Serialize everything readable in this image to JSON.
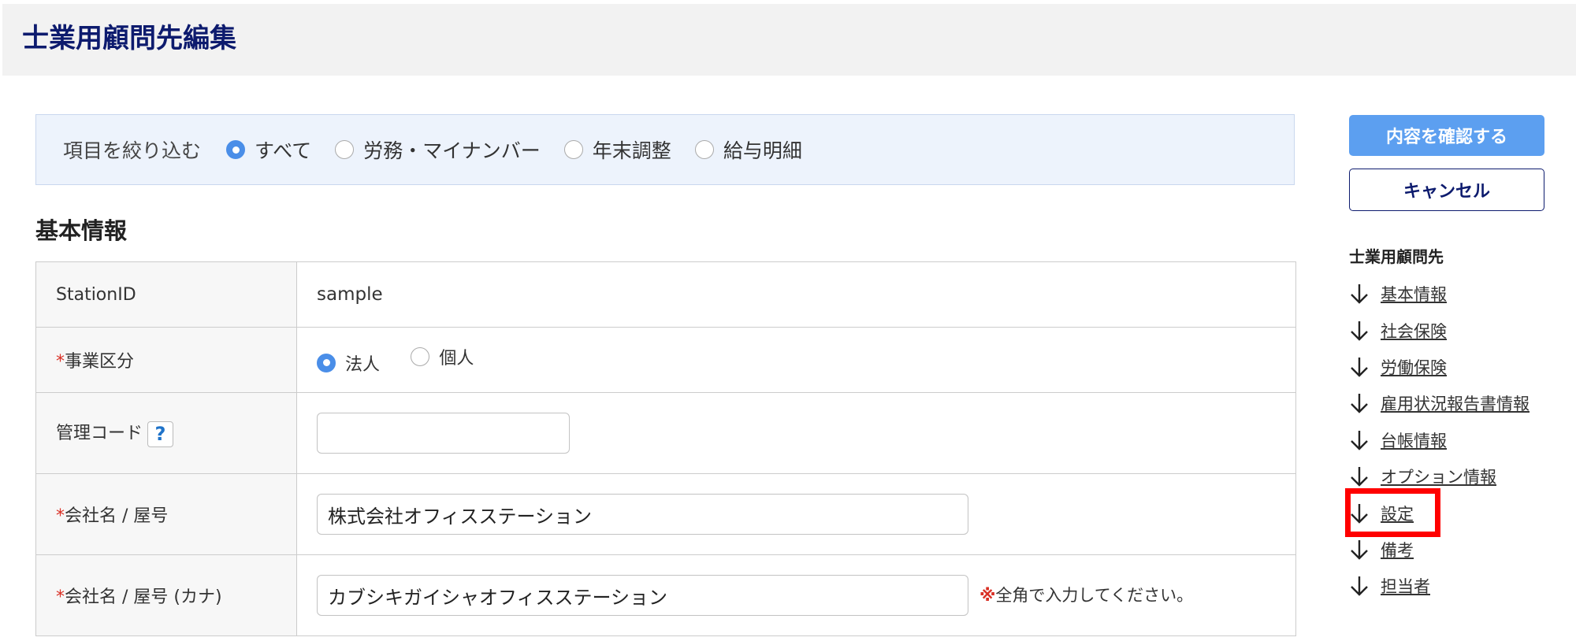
{
  "header": {
    "title": "士業用顧問先編集"
  },
  "filter": {
    "label": "項目を絞り込む",
    "options": [
      {
        "label": "すべて",
        "selected": true
      },
      {
        "label": "労務・マイナンバー",
        "selected": false
      },
      {
        "label": "年末調整",
        "selected": false
      },
      {
        "label": "給与明細",
        "selected": false
      }
    ]
  },
  "section": {
    "title": "基本情報"
  },
  "form": {
    "station_id": {
      "label": "StationID",
      "value": "sample"
    },
    "business_type": {
      "required_mark": "*",
      "label": "事業区分",
      "options": [
        {
          "label": "法人",
          "selected": true
        },
        {
          "label": "個人",
          "selected": false
        }
      ]
    },
    "management_code": {
      "label": "管理コード",
      "help": "?",
      "value": ""
    },
    "company_name": {
      "required_mark": "*",
      "label": "会社名 / 屋号",
      "value": "株式会社オフィスステーション"
    },
    "company_name_kana": {
      "required_mark": "*",
      "label": "会社名 / 屋号 (カナ)",
      "value": "カブシキガイシャオフィスステーション",
      "note_mark": "※",
      "note": "全角で入力してください。"
    }
  },
  "actions": {
    "confirm_label": "内容を確認する",
    "cancel_label": "キャンセル"
  },
  "sidebar": {
    "title": "士業用顧問先",
    "links": [
      "基本情報",
      "社会保険",
      "労働保険",
      "雇用状況報告書情報",
      "台帳情報",
      "オプション情報",
      "設定",
      "備考",
      "担当者"
    ]
  },
  "colors": {
    "primary": "#5c9ff0",
    "navy": "#0d1b6e",
    "required": "#d93025",
    "highlight": "#ff0000"
  }
}
